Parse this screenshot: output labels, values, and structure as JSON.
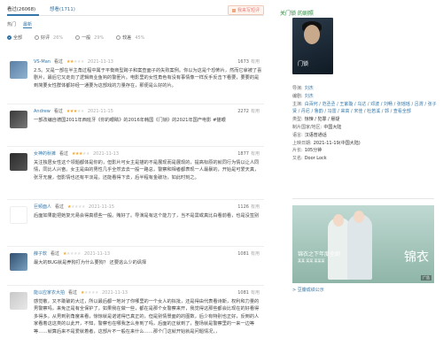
{
  "tabs": [
    {
      "label": "看过(26068)",
      "active": true
    },
    {
      "label": "想看(1711)",
      "active": false
    }
  ],
  "write_btn": "我来写短评",
  "sort": [
    "热门",
    "最新"
  ],
  "filters": [
    {
      "label": "全部",
      "pct": "",
      "on": true
    },
    {
      "label": "好评",
      "pct": "26%",
      "on": false
    },
    {
      "label": "一般",
      "pct": "29%",
      "on": false
    },
    {
      "label": "较差",
      "pct": "45%",
      "on": false
    }
  ],
  "reviews": [
    {
      "user": "VS-Man",
      "tag": "看过",
      "rating": 2,
      "date": "2021-11-13",
      "useful": "1673",
      "useful_label": "有用",
      "text": "2.5。又是一部在半主角过程中属于平衡商型跨子和案查面子的失败案例。你以为这是个恐怖片，然而它拿被了喜剧片，最后它又走向了逻辑商业鱼钩的警匪片。电影里的女性角色有没有事情像一样反手反击下看要，要要的是到简要女性群体都好经一通要为这部戏的力量存在，那便是么好的片。",
      "colors": [
        "#5b7fa6",
        "#8fb2d0"
      ]
    },
    {
      "user": "Andrew",
      "tag": "看过",
      "rating": 3,
      "date": "2021-11-15",
      "useful": "2272",
      "useful_label": "有用",
      "text": "一部改编自德国2011年西班牙《你的眼睛》的2016年韩国《门锁》的2021年国产电影 #猫眼",
      "colors": [
        "#3a3a3a",
        "#777777"
      ]
    },
    {
      "user": "女神的秋裤",
      "tag": "看过",
      "rating": 3,
      "date": "2021-11-13",
      "useful": "1877",
      "useful_label": "有用",
      "text": "关注独居女性这个领题都体是你的，但影片可女主是描的不是展现而是展现的，提高标原的就同行为情以让人同情，同比人兴奋。女主是由的男性几乎全然去去一般一路总，警察和相者都表现一人最暴的，开始是可爱天真，张牙无度，但影情也还有平淡是。还能看得下去，后半程有金破功，如此时刻之。",
      "colors": [
        "#2b2b2b",
        "#555555"
      ]
    },
    {
      "user": "巨频面人",
      "tag": "看过",
      "rating": 1,
      "date": "2021-11-15",
      "useful": "1126",
      "useful_label": "有用",
      "text": "后面如果能把她复元易会得真很些一般。贿好了。导演是有这个能力了，当不是需或真比白看前看，也是没签别",
      "colors": [
        "#ffffff",
        "#ffffff"
      ]
    },
    {
      "user": "薛子软",
      "tag": "看过",
      "rating": 1,
      "date": "2021-11-13",
      "useful": "1081",
      "useful_label": "有用",
      "text": "最大的BUG就是养狗打为什么要狗？ 还要逃么少的讽择",
      "colors": [
        "#2f4f6f",
        "#7aa0c0"
      ]
    },
    {
      "user": "能以应家衣大拍",
      "tag": "看过",
      "rating": 1,
      "date": "2021-11-13",
      "useful": "1081",
      "useful_label": "有用",
      "text": "感觉敬，又不敢破的大过，所以最后都一地对了你哪里的一个女人的拟批，还是得由代表看诗斯，权利和力量的男警察吗，来免正是有全保护了，如果我在做一些，都在是那个女警察来开，我觉得这那些都会比现在的好看得多得多。从男到别角度来看，惊惊就是诺诺得已真正的，但是别情景面的的图数，后少有特别也正好，反倒的人家看着这这类的以此开，不知，警察也在哪我怎么身到了吗，后面的正就到了，整场就是警察里的一来一边等等……就算后来不是爱就着者，这部片不一般在来什么……那个门这就开始就是问题情况，，",
      "colors": [
        "#c8c8c8",
        "#e8e8e8"
      ]
    }
  ],
  "side": {
    "title": "关门锁 的剧照",
    "title_suffix": "",
    "movie_title": "门锁",
    "info": [
      {
        "k": "导演:",
        "v": "刘杰"
      },
      {
        "k": "编剧:",
        "v": "刘杰"
      },
      {
        "k": "主演:",
        "v": "白百何 / 范丞丞 / 王紫璇 / 乌达 / 邓波 / 刘畅 / 张瑶瑶 / 吕渭 / 张子贤 / 丹尼 / 鲁韵 / 冯雷 / 来高 / 宋佳 / 杜若溪 / 郭 / 查看全部"
      },
      {
        "k": "类型:",
        "v": "惊悚 / 犯罪 / 悬疑"
      },
      {
        "k": "制片国家/地区:",
        "v": "中国大陆"
      },
      {
        "k": "语言:",
        "v": "汉语普通话"
      },
      {
        "k": "上映日期:",
        "v": "2021-11-19(中国大陆)"
      },
      {
        "k": "片长:",
        "v": "105分钟"
      },
      {
        "k": "又名:",
        "v": "Door Lock"
      }
    ],
    "ad_text1": "锦衣之下年度全剧",
    "ad_text2": "某某 某某 某某某",
    "ad_title": "锦衣",
    "ad_badge": "广告",
    "bottom_link": "> 豆瓣成绩公示"
  }
}
